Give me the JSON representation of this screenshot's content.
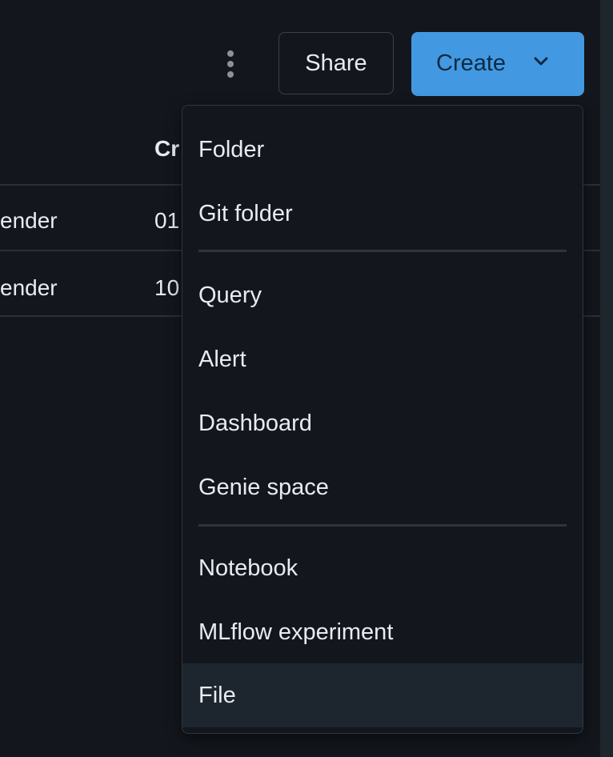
{
  "toolbar": {
    "more_options_icon": "kebab-vertical-icon",
    "share_label": "Share",
    "create_label": "Create",
    "create_chevron_icon": "chevron-down-icon",
    "create_color": "#4299e1"
  },
  "table": {
    "visible_header_fragment": "Cr",
    "rows": [
      {
        "name_fragment": "ender",
        "date_fragment": "01"
      },
      {
        "name_fragment": "ender",
        "date_fragment": "10"
      }
    ]
  },
  "create_menu": {
    "groups": [
      [
        "Folder",
        "Git folder"
      ],
      [
        "Query",
        "Alert",
        "Dashboard",
        "Genie space"
      ],
      [
        "Notebook",
        "MLflow experiment",
        "File"
      ]
    ],
    "hovered_item": "File"
  }
}
